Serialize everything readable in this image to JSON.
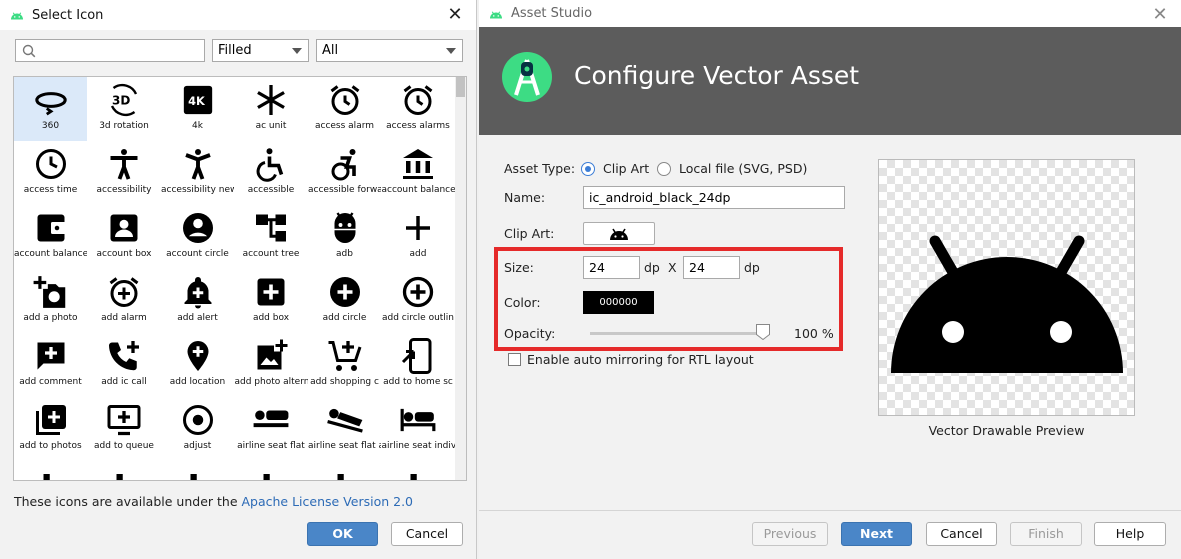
{
  "select_icon_dialog": {
    "title": "Select Icon",
    "search": {
      "value": "",
      "placeholder": ""
    },
    "style_dropdown": "Filled",
    "category_dropdown": "All",
    "icons": [
      {
        "label": "360",
        "icon": "360-icon"
      },
      {
        "label": "3d rotation",
        "icon": "3d-rotation-icon"
      },
      {
        "label": "4k",
        "icon": "4k-icon"
      },
      {
        "label": "ac unit",
        "icon": "ac-unit-icon"
      },
      {
        "label": "access alarm",
        "icon": "access-alarm-icon"
      },
      {
        "label": "access alarms",
        "icon": "access-alarms-icon"
      },
      {
        "label": "access time",
        "icon": "access-time-icon"
      },
      {
        "label": "accessibility",
        "icon": "accessibility-icon"
      },
      {
        "label": "accessibility new",
        "icon": "accessibility-new-icon"
      },
      {
        "label": "accessible",
        "icon": "accessible-icon"
      },
      {
        "label": "accessible forwa",
        "icon": "accessible-forward-icon"
      },
      {
        "label": "account balance",
        "icon": "account-balance-icon"
      },
      {
        "label": "account balance",
        "icon": "account-balance-wallet-icon"
      },
      {
        "label": "account box",
        "icon": "account-box-icon"
      },
      {
        "label": "account circle",
        "icon": "account-circle-icon"
      },
      {
        "label": "account tree",
        "icon": "account-tree-icon"
      },
      {
        "label": "adb",
        "icon": "adb-icon"
      },
      {
        "label": "add",
        "icon": "add-icon"
      },
      {
        "label": "add a photo",
        "icon": "add-a-photo-icon"
      },
      {
        "label": "add alarm",
        "icon": "add-alarm-icon"
      },
      {
        "label": "add alert",
        "icon": "add-alert-icon"
      },
      {
        "label": "add box",
        "icon": "add-box-icon"
      },
      {
        "label": "add circle",
        "icon": "add-circle-icon"
      },
      {
        "label": "add circle outlin",
        "icon": "add-circle-outline-icon"
      },
      {
        "label": "add comment",
        "icon": "add-comment-icon"
      },
      {
        "label": "add ic call",
        "icon": "add-ic-call-icon"
      },
      {
        "label": "add location",
        "icon": "add-location-icon"
      },
      {
        "label": "add photo altern",
        "icon": "add-photo-alternate-icon"
      },
      {
        "label": "add shopping c",
        "icon": "add-shopping-cart-icon"
      },
      {
        "label": "add to home sc",
        "icon": "add-to-home-screen-icon"
      },
      {
        "label": "add to photos",
        "icon": "add-to-photos-icon"
      },
      {
        "label": "add to queue",
        "icon": "add-to-queue-icon"
      },
      {
        "label": "adjust",
        "icon": "adjust-icon"
      },
      {
        "label": "airline seat flat",
        "icon": "airline-seat-flat-icon"
      },
      {
        "label": "airline seat flat a",
        "icon": "airline-seat-flat-angled-icon"
      },
      {
        "label": "airline seat indiv",
        "icon": "airline-seat-individual-suite-icon"
      }
    ],
    "license_text": "These icons are available under the ",
    "license_link": "Apache License Version 2.0",
    "ok_label": "OK",
    "cancel_label": "Cancel"
  },
  "asset_studio": {
    "window_title": "Asset Studio",
    "header_title": "Configure Vector Asset",
    "asset_type_label": "Asset Type:",
    "asset_type_options": [
      "Clip Art",
      "Local file (SVG, PSD)"
    ],
    "asset_type_selected": "Clip Art",
    "name_label": "Name:",
    "name_value": "ic_android_black_24dp",
    "clip_art_label": "Clip Art:",
    "clip_art_icon": "android-icon",
    "size_label": "Size:",
    "width_value": "24",
    "height_value": "24",
    "unit": "dp",
    "size_separator": "X",
    "color_label": "Color:",
    "color_value": "000000",
    "opacity_label": "Opacity:",
    "opacity_value": 100,
    "opacity_text": "100 %",
    "rtl_label": "Enable auto mirroring for RTL layout",
    "rtl_checked": false,
    "preview_caption": "Vector Drawable Preview",
    "buttons": {
      "previous": "Previous",
      "next": "Next",
      "cancel": "Cancel",
      "finish": "Finish",
      "help": "Help"
    }
  }
}
